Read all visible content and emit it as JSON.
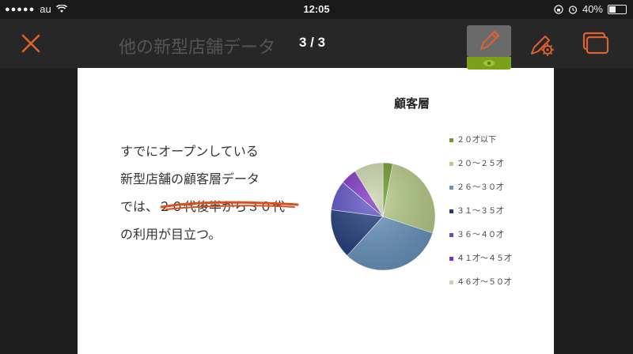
{
  "status_bar": {
    "signal": "●●●●●",
    "carrier": "au",
    "time": "12:05",
    "battery_percent": "40%",
    "battery_level": 0.4
  },
  "toolbar": {
    "slide_title": "他の新型店舗データ",
    "page_indicator": "3 / 3"
  },
  "slide": {
    "body_lines": [
      "すでにオープンしている",
      "新型店舗の顧客層データ",
      "では、２０代後半から３０代",
      "の利用が目立つ。"
    ]
  },
  "chart_data": {
    "type": "pie",
    "title": "顧客層",
    "categories": [
      "２０才以下",
      "２０～２５才",
      "２６～３０才",
      "３１～３５才",
      "３６～４０才",
      "４１才～４５才",
      "４６才～５０才"
    ],
    "values": [
      3,
      27,
      32,
      15,
      9,
      5,
      9
    ],
    "colors": [
      "#6b9a2c",
      "#b6cc88",
      "#6a93bc",
      "#1f3b7a",
      "#5a4fc4",
      "#7b2fc0",
      "#c8d4a8"
    ],
    "legend_position": "right"
  },
  "colors": {
    "accent": "#e0602e",
    "pen_active": "#7aa01c",
    "annotation": "#d9501e"
  }
}
